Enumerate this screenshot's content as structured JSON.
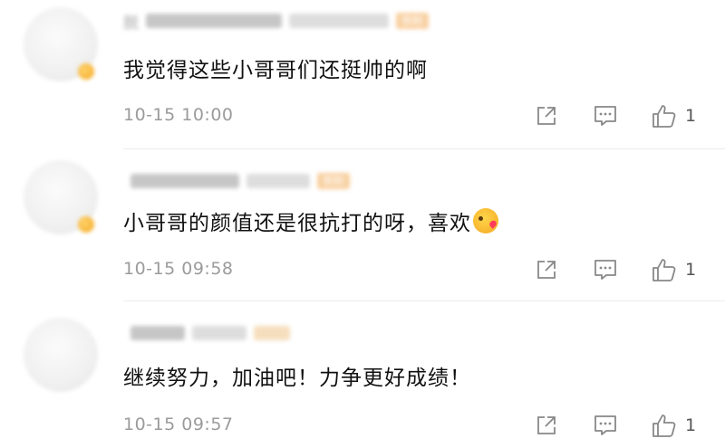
{
  "comments": [
    {
      "username": "脱",
      "fan_badge": "铁粉",
      "text": "我觉得这些小哥哥们还挺帅的啊",
      "emoji": "",
      "time": "10-15 10:00",
      "likes": "1"
    },
    {
      "username": "",
      "fan_badge": "铁粉",
      "text": "小哥哥的颜值还是很抗打的呀，喜欢",
      "emoji": "kiss-emoji",
      "time": "10-15 09:58",
      "likes": "1"
    },
    {
      "username": "",
      "fan_badge": "",
      "text": "继续努力，加油吧！力争更好成绩！",
      "emoji": "",
      "time": "10-15 09:57",
      "likes": "1"
    }
  ],
  "icons": {
    "share": "share-icon",
    "reply": "comment-icon",
    "like": "thumb-up-icon"
  }
}
